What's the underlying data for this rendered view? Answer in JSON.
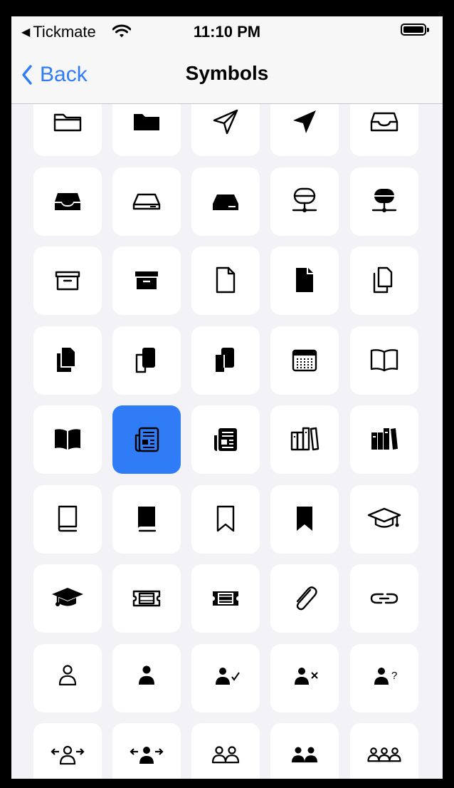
{
  "status_bar": {
    "back_app": "Tickmate",
    "time": "11:10 PM"
  },
  "nav": {
    "back_label": "Back",
    "title": "Symbols"
  },
  "accent": "#2f7cf6",
  "symbols": [
    [
      "folder-icon",
      "folder-fill-icon",
      "paperplane-icon",
      "paperplane-fill-icon",
      "tray-icon"
    ],
    [
      "tray-fill-icon",
      "externaldrive-icon",
      "externaldrive-fill-icon",
      "server-rack-icon",
      "server-rack-fill-icon"
    ],
    [
      "archivebox-icon",
      "archivebox-fill-icon",
      "doc-icon",
      "doc-fill-icon",
      "doc-on-doc-icon"
    ],
    [
      "doc-on-doc-fill-icon",
      "phone-doc-icon",
      "phone-doc-fill-icon",
      "calendar-icon",
      "book-icon"
    ],
    [
      "book-fill-icon",
      "newspaper-icon",
      "newspaper-fill-icon",
      "books-vertical-icon",
      "books-vertical-fill-icon"
    ],
    [
      "book-closed-icon",
      "book-closed-fill-icon",
      "bookmark-icon",
      "bookmark-fill-icon",
      "graduationcap-icon"
    ],
    [
      "graduationcap-fill-icon",
      "ticket-icon",
      "ticket-fill-icon",
      "paperclip-icon",
      "link-icon"
    ],
    [
      "person-icon",
      "person-fill-icon",
      "person-fill-checkmark-icon",
      "person-fill-xmark-icon",
      "person-fill-questionmark-icon"
    ],
    [
      "person-fill-turn-left-right-icon",
      "person-fill-arrows-icon",
      "person-2-icon",
      "person-2-fill-icon",
      "person-3-icon"
    ]
  ],
  "selected_symbol": "newspaper-icon"
}
